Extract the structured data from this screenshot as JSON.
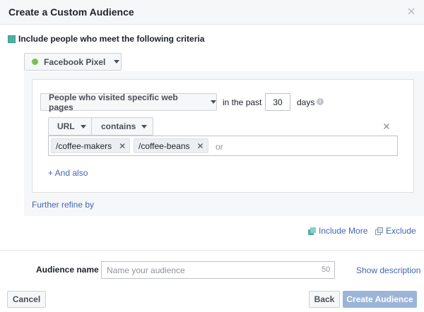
{
  "header": {
    "title": "Create a Custom Audience",
    "close_icon": "close-icon"
  },
  "criteria": {
    "label": "Include people who meet the following criteria",
    "accent": "#4ab2a4"
  },
  "source": {
    "label": "Facebook Pixel",
    "status_color": "#7bc14e"
  },
  "rule": {
    "audience_type": "People who visited specific web pages",
    "in_the_past_label": "in the past",
    "days_value": "30",
    "days_label": "days",
    "info_icon": "info-icon",
    "field": "URL",
    "operator": "contains",
    "tokens": [
      "/coffee-makers",
      "/coffee-beans"
    ],
    "or_placeholder": "or",
    "and_also": "+ And also"
  },
  "refine_label": "Further refine by",
  "include_more": "Include More",
  "exclude": "Exclude",
  "audience_name": {
    "label": "Audience name",
    "placeholder": "Name your audience",
    "char_limit": "50",
    "show_description": "Show description"
  },
  "footer": {
    "cancel": "Cancel",
    "back": "Back",
    "create": "Create Audience"
  },
  "colors": {
    "link": "#4267b2",
    "primary_disabled": "#9cb4d8"
  }
}
